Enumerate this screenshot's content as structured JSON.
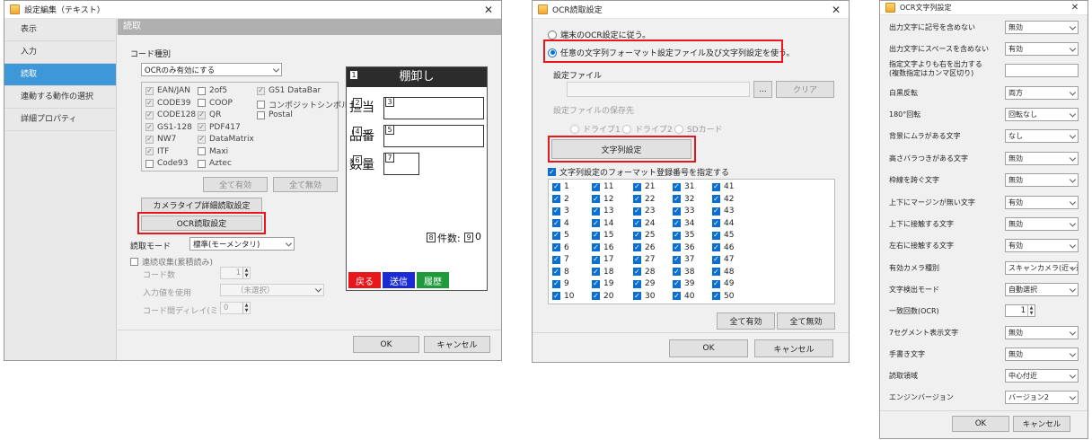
{
  "win1": {
    "title": "設定編集（テキスト）",
    "sidebar": [
      "表示",
      "入力",
      "読取",
      "連動する動作の選択",
      "詳細プロパティ"
    ],
    "active_index": 2,
    "header": "読取",
    "code_type_label": "コード種別",
    "code_type_value": "OCRのみ有効にする",
    "codes": [
      {
        "label": "EAN/JAN",
        "checked": true
      },
      {
        "label": "2of5",
        "checked": false
      },
      {
        "label": "GS1 DataBar",
        "checked": true
      },
      {
        "label": "CODE39",
        "checked": true
      },
      {
        "label": "COOP",
        "checked": false
      },
      {
        "label": "コンポジットシンボル",
        "checked": false
      },
      {
        "label": "CODE128",
        "checked": true
      },
      {
        "label": "QR",
        "checked": true
      },
      {
        "label": "Postal",
        "checked": false
      },
      {
        "label": "GS1-128",
        "checked": true
      },
      {
        "label": "PDF417",
        "checked": true
      },
      {
        "label": "NW7",
        "checked": true
      },
      {
        "label": "DataMatrix",
        "checked": true
      },
      {
        "label": "ITF",
        "checked": true
      },
      {
        "label": "Maxi",
        "checked": false
      },
      {
        "label": "Code93",
        "checked": false
      },
      {
        "label": "Aztec",
        "checked": false
      }
    ],
    "all_enable": "全て有効",
    "all_disable": "全て無効",
    "camera_btn": "カメラタイプ詳細読取設定",
    "ocr_btn": "OCR読取設定",
    "read_mode_label": "読取モード",
    "read_mode_value": "標準(モーメンタリ)",
    "continuous_label": "連続収集(累積読み)",
    "code_count_label": "コード数",
    "code_count_value": "1",
    "input_value_label": "入力値を使用",
    "input_value_value": "（未選択）",
    "delay_label": "コード間ディレイ(ミリ秒)",
    "delay_value": "0",
    "ok": "OK",
    "cancel": "キャンセル",
    "preview": {
      "title": "棚卸し",
      "tags": [
        "1",
        "2",
        "3",
        "4",
        "5",
        "6",
        "7",
        "8",
        "9"
      ],
      "row1": "担当",
      "row2": "品番",
      "row3": "数量",
      "count_label": "件数:",
      "count_suffix": "0",
      "btn_back": "戻る",
      "btn_send": "送信",
      "btn_history": "履歴"
    }
  },
  "win2": {
    "title": "OCR読取設定",
    "radio1": "端末のOCR設定に従う。",
    "radio2": "任意の文字列フォーマット設定ファイル及び文字列設定を使う。",
    "settings_file_label": "設定ファイル",
    "browse": "...",
    "clear": "クリア",
    "save_dest_label": "設定ファイルの保存先",
    "drive1": "ドライブ1",
    "drive2": "ドライブ2",
    "sdcard": "SDカード",
    "string_btn": "文字列設定",
    "format_check": "文字列設定のフォーマット登録番号を指定する",
    "numbers": [
      "1",
      "2",
      "3",
      "4",
      "5",
      "6",
      "7",
      "8",
      "9",
      "10",
      "11",
      "12",
      "13",
      "14",
      "15",
      "16",
      "17",
      "18",
      "19",
      "20",
      "21",
      "22",
      "23",
      "24",
      "25",
      "26",
      "27",
      "28",
      "29",
      "30",
      "31",
      "32",
      "33",
      "34",
      "35",
      "36",
      "37",
      "38",
      "39",
      "40",
      "41",
      "42",
      "43",
      "44",
      "45",
      "46",
      "47",
      "48",
      "49",
      "50"
    ],
    "all_enable": "全て有効",
    "all_disable": "全て無効",
    "ok": "OK",
    "cancel": "キャンセル"
  },
  "win3": {
    "title": "OCR文字列設定",
    "rows": [
      {
        "label": "出力文字に記号を含めない",
        "value": "無効",
        "type": "select"
      },
      {
        "label": "出力文字にスペースを含めない",
        "value": "有効",
        "type": "select"
      },
      {
        "label": "指定文字よりも右を出力する\n(複数指定はカンマ区切り)",
        "value": "",
        "type": "text"
      },
      {
        "label": "白黒反転",
        "value": "両方",
        "type": "select"
      },
      {
        "label": "180°回転",
        "value": "回転なし",
        "type": "select"
      },
      {
        "label": "背景にムラがある文字",
        "value": "なし",
        "type": "select"
      },
      {
        "label": "高さバラつきがある文字",
        "value": "無効",
        "type": "select"
      },
      {
        "label": "枠線を跨ぐ文字",
        "value": "無効",
        "type": "select"
      },
      {
        "label": "上下にマージンが無い文字",
        "value": "有効",
        "type": "select"
      },
      {
        "label": "上下に接触する文字",
        "value": "無効",
        "type": "select"
      },
      {
        "label": "左右に接触する文字",
        "value": "有効",
        "type": "select"
      },
      {
        "label": "有効カメラ種別",
        "value": "スキャンカメラ(近・遠)",
        "type": "select"
      },
      {
        "label": "文字検出モード",
        "value": "自動選択",
        "type": "select"
      },
      {
        "label": "一致回数(OCR)",
        "value": "1",
        "type": "number"
      },
      {
        "label": "7セグメント表示文字",
        "value": "無効",
        "type": "select"
      },
      {
        "label": "手書き文字",
        "value": "無効",
        "type": "select"
      },
      {
        "label": "読取領域",
        "value": "中心付近",
        "type": "select"
      },
      {
        "label": "エンジンバージョン",
        "value": "バージョン2",
        "type": "select"
      }
    ],
    "ok": "OK",
    "cancel": "キャンセル"
  },
  "colors": {
    "accent": "#3e98d8",
    "highlight": "#e8171c",
    "check": "#0a6fd0",
    "back": "#e8171c",
    "send": "#1a2bd6",
    "history": "#1e9a3a"
  }
}
